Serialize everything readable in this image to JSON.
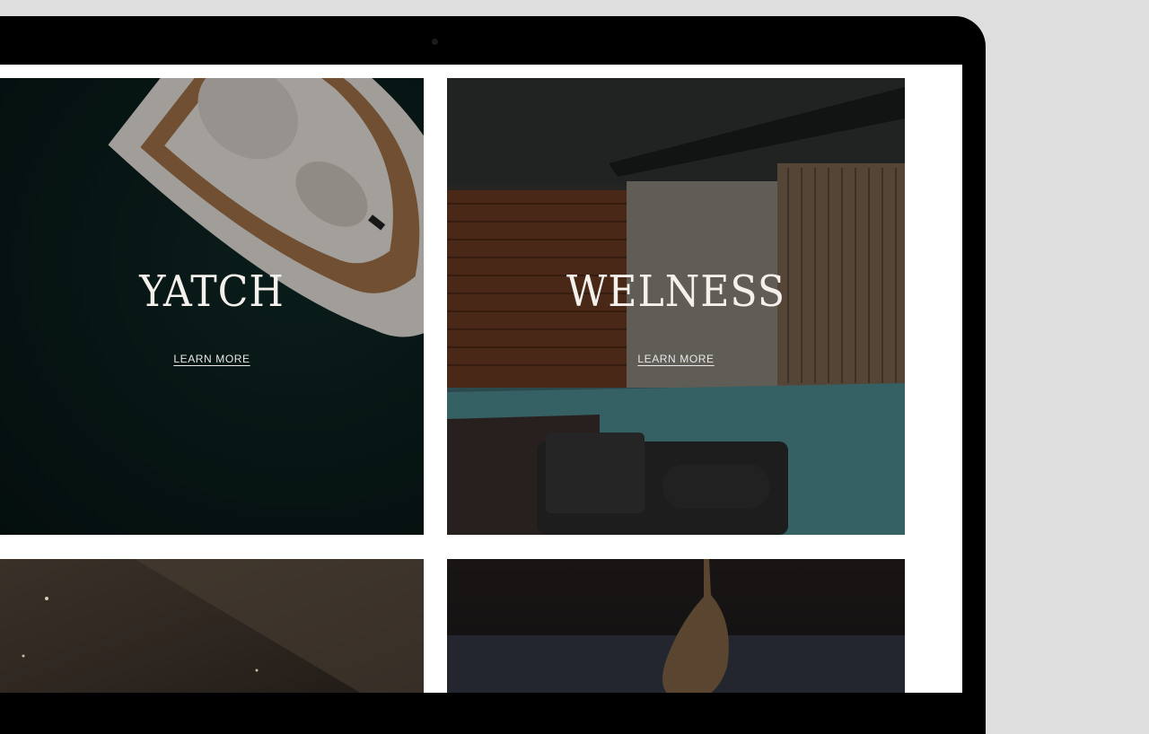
{
  "tiles": [
    {
      "title": "YATCH",
      "link": "LEARN MORE"
    },
    {
      "title": "WELNESS",
      "link": "LEARN MORE"
    }
  ],
  "colors": {
    "frame": "#000000",
    "backdrop": "#dedede",
    "sea": "#0a1d1b",
    "pool": "#3f6a70",
    "text": "#f4f1ec"
  },
  "icons": [
    "camera-dot"
  ]
}
